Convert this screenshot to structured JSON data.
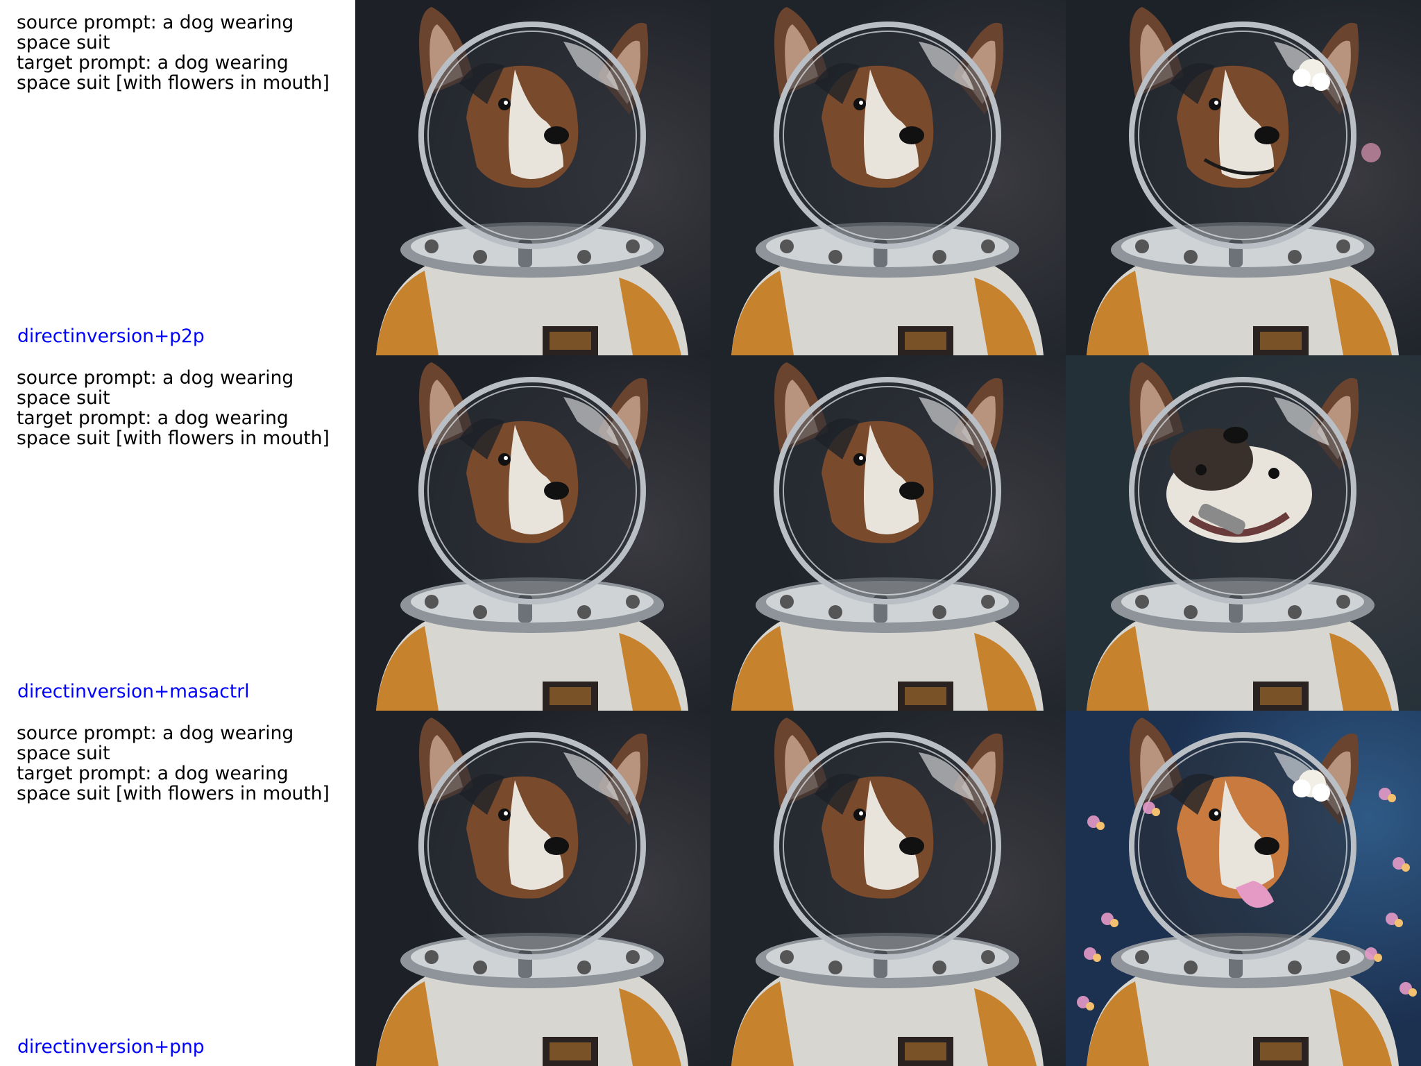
{
  "rows": [
    {
      "source_prompt": "source prompt: a dog wearing space suit",
      "target_prompt": "target prompt: a dog wearing space suit [with flowers in mouth]",
      "method": "directinversion+p2p",
      "images": [
        {
          "name": "source-image",
          "variant": "plain",
          "bg": "#1d2127"
        },
        {
          "name": "reconstruction-image",
          "variant": "plain",
          "bg": "#1f242a"
        },
        {
          "name": "edited-image",
          "variant": "white-flower",
          "bg": "#1c2228"
        }
      ]
    },
    {
      "source_prompt": "source prompt: a dog wearing space suit",
      "target_prompt": "target prompt: a dog wearing space suit [with flowers in mouth]",
      "method": "directinversion+masactrl",
      "images": [
        {
          "name": "source-image",
          "variant": "plain",
          "bg": "#1d2127"
        },
        {
          "name": "reconstruction-image",
          "variant": "plain",
          "bg": "#1f242a"
        },
        {
          "name": "edited-image",
          "variant": "face-up",
          "bg": "#243038"
        }
      ]
    },
    {
      "source_prompt": "source prompt: a dog wearing space suit",
      "target_prompt": "target prompt: a dog wearing space suit [with flowers in mouth]",
      "method": "directinversion+pnp",
      "images": [
        {
          "name": "source-image",
          "variant": "plain",
          "bg": "#1d2127"
        },
        {
          "name": "reconstruction-image",
          "variant": "plain",
          "bg": "#1f242a"
        },
        {
          "name": "edited-image",
          "variant": "flowers",
          "bg": "#1c3050"
        }
      ]
    }
  ],
  "colors": {
    "method_label": "#0000ff",
    "prompt_text": "#000000",
    "suit_orange": "#c7822e",
    "suit_white": "#d8d6d0",
    "fur_brown": "#7a4a2c",
    "fur_white": "#e8e4dc",
    "flower_pink": "#e59ac6"
  }
}
